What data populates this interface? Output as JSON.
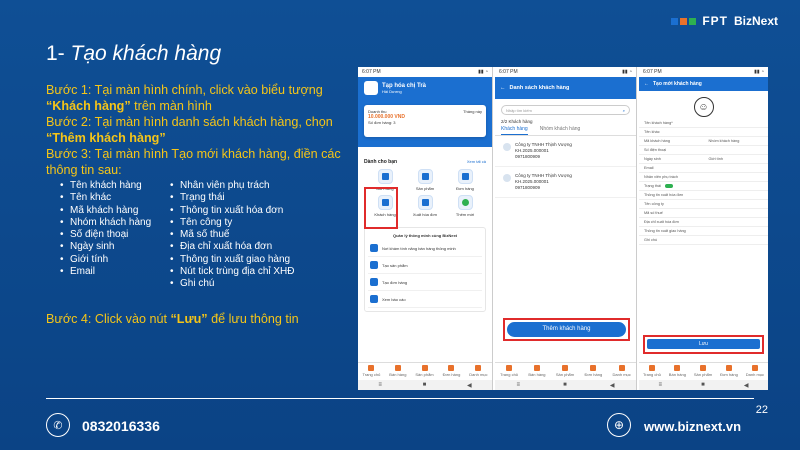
{
  "brand": {
    "fpt": "FPT",
    "biznext": "BizNext",
    "colors": {
      "blue": "#1B6FD0",
      "orange": "#E8712B",
      "green": "#2EB050"
    }
  },
  "title": {
    "number": "1- ",
    "text": "Tạo khách hàng"
  },
  "steps": {
    "step1_pre": "Bước 1: Tại màn hình chính, click vào biểu tượng ",
    "step1_bold": "“Khách hàng”",
    "step1_post": " trên màn hình",
    "step2_pre": "Bước 2: Tại màn hình danh sách khách hàng, chọn ",
    "step2_bold": "“Thêm khách hàng”",
    "step3": "Bước 3: Tại màn hình Tạo mới khách hàng, điền các thông tin sau:",
    "fields_col1": [
      "Tên khách hàng",
      "Tên khác",
      "Mã khách hàng",
      "Nhóm khách hàng",
      "Số điện thoại",
      "Ngày sinh",
      "Giới tính",
      "Email"
    ],
    "fields_col2": [
      "Nhân viên phụ trách",
      "Trạng thái",
      "Thông tin xuất hóa đơn",
      "Tên công ty",
      "Mã số thuế",
      "Địa chỉ xuất hóa đơn",
      "Thông tin xuất giao hàng",
      "Nút tick trùng địa chỉ XHĐ",
      "Ghi chú"
    ],
    "step4_pre": "Bước 4: Click vào nút ",
    "step4_bold": "“Lưu”",
    "step4_post": " để lưu thông tin"
  },
  "phone_common": {
    "time": "6:07 PM",
    "tabs": [
      "Trang chủ",
      "Bán hàng",
      "Sản phẩm",
      "Đơn hàng",
      "Danh mục"
    ]
  },
  "phone1": {
    "store_name": "Tạp hóa chị Trà",
    "store_sub": "Hải Dương",
    "revenue_label": "Doanh thu",
    "revenue_value": "10.000.000 VND",
    "period": "Tháng này",
    "orders_label": "Số đơn hàng: 3",
    "section": "Dành cho bạn",
    "more": "Xem tất cả",
    "tiles": [
      "Bán hàng",
      "Sản phẩm",
      "Đơn hàng",
      "Khách hàng",
      "Xuất hóa đơn",
      "Thêm mới"
    ],
    "promo_title": "Quản lý thông minh cùng BizNext",
    "promo_rows": [
      "Nơi khám tính năng bán hàng thông minh",
      "Tạo sản phẩm",
      "Tạo đơn hàng",
      "Xem báo cáo"
    ]
  },
  "phone2": {
    "header": "Danh sách khách hàng",
    "search_placeholder": "Nhập tìm kiếm",
    "count": "2/2 Khách hàng",
    "tab_customers": "Khách hàng",
    "tab_groups": "Nhóm khách hàng",
    "customers": [
      {
        "name": "Công ty TNHH Thịnh Vượng",
        "code": "KH.2025.000001",
        "phone": "0971800909"
      },
      {
        "name": "Công ty TNHH Thịnh Vượng",
        "code": "KH.2025.000001",
        "phone": "0971800909"
      }
    ],
    "add_button": "Thêm khách hàng"
  },
  "phone3": {
    "header": "Tạo mới khách hàng",
    "fields": {
      "name": "Tên khách hàng*",
      "alias": "Tên khác",
      "code": "Mã khách hàng",
      "group": "Nhóm khách hàng",
      "phone": "Số điện thoại",
      "dob": "Ngày sinh",
      "gender": "Giới tính",
      "email": "Email",
      "staff": "Nhân viên phụ trách",
      "status": "Trạng thái",
      "invoice": "Thông tin xuất hóa đơn",
      "company": "Tên công ty",
      "tax": "Mã số thuế",
      "invoice_addr": "Địa chỉ xuất hóa đơn",
      "delivery": "Thông tin xuất giao hàng",
      "note": "Ghi chú"
    },
    "save_button": "Lưu"
  },
  "page_number": "22",
  "footer": {
    "phone": "0832016336",
    "website": "www.biznext.vn"
  }
}
